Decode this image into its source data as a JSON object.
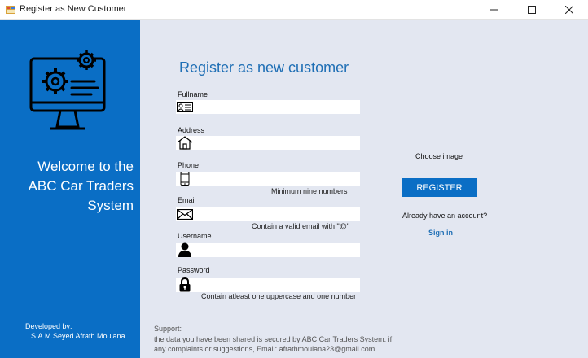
{
  "window": {
    "title": "Register as New Customer"
  },
  "sidebar": {
    "welcome": "Welcome to the\nABC Car Traders\nSystem",
    "developed_by_label": "Developed by:",
    "developer_name": "S.A.M Seyed Afrath Moulana"
  },
  "form": {
    "title": "Register as new customer",
    "fields": {
      "fullname": {
        "label": "Fullname",
        "value": "",
        "icon": "id-card-icon"
      },
      "address": {
        "label": "Address",
        "value": "",
        "icon": "home-icon"
      },
      "phone": {
        "label": "Phone",
        "value": "",
        "icon": "mobile-phone-icon",
        "hint": "Minimum nine numbers"
      },
      "email": {
        "label": "Email",
        "value": "",
        "icon": "envelope-icon",
        "hint": "Contain a valid email with \"@\""
      },
      "username": {
        "label": "Username",
        "value": "",
        "icon": "user-icon"
      },
      "password": {
        "label": "Password",
        "value": "",
        "icon": "lock-icon",
        "hint": "Contain atleast one uppercase and one number"
      }
    },
    "choose_image": "Choose image",
    "register_label": "REGISTER",
    "already_account": "Already have an account?",
    "signin_label": "Sign in"
  },
  "support": {
    "label": "Support:",
    "text": "the data you have been shared is secured by ABC Car Traders System. if any complaints or suggestions, Email: afrathmoulana23@gmail.com"
  },
  "colors": {
    "brand_blue": "#0a6ec5",
    "title_blue": "#1f6fb5",
    "form_background": "#e3e7f1"
  }
}
